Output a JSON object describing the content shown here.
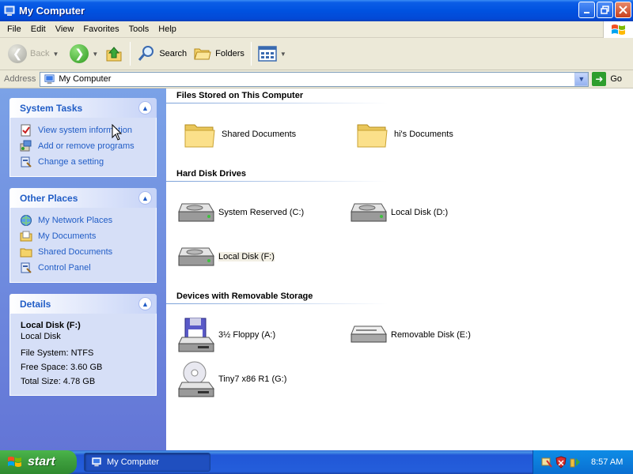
{
  "window": {
    "title": "My Computer",
    "menus": [
      "File",
      "Edit",
      "View",
      "Favorites",
      "Tools",
      "Help"
    ]
  },
  "toolbar": {
    "back_label": "Back",
    "search_label": "Search",
    "folders_label": "Folders"
  },
  "address": {
    "label": "Address",
    "value": "My Computer",
    "go_label": "Go"
  },
  "sidebar": {
    "system_tasks": {
      "title": "System Tasks",
      "items": [
        {
          "label": "View system information",
          "icon": "system-info-icon"
        },
        {
          "label": "Add or remove programs",
          "icon": "add-remove-programs-icon"
        },
        {
          "label": "Change a setting",
          "icon": "control-panel-icon"
        }
      ]
    },
    "other_places": {
      "title": "Other Places",
      "items": [
        {
          "label": "My Network Places",
          "icon": "network-places-icon"
        },
        {
          "label": "My Documents",
          "icon": "my-documents-icon"
        },
        {
          "label": "Shared Documents",
          "icon": "folder-icon"
        },
        {
          "label": "Control Panel",
          "icon": "control-panel-icon"
        }
      ]
    },
    "details": {
      "title": "Details",
      "name": "Local Disk (F:)",
      "type": "Local Disk",
      "file_system": "File System: NTFS",
      "free_space": "Free Space: 3.60 GB",
      "total_size": "Total Size: 4.78 GB"
    }
  },
  "main": {
    "sections": [
      {
        "title": "Files Stored on This Computer",
        "items": [
          {
            "label": "Shared Documents",
            "icon": "folder-icon"
          },
          {
            "label": "hi's Documents",
            "icon": "folder-icon"
          }
        ]
      },
      {
        "title": "Hard Disk Drives",
        "items": [
          {
            "label": "System Reserved (C:)",
            "icon": "hard-disk-icon"
          },
          {
            "label": "Local Disk (D:)",
            "icon": "hard-disk-icon"
          },
          {
            "label": "Local Disk (F:)",
            "icon": "hard-disk-icon"
          }
        ]
      },
      {
        "title": "Devices with Removable Storage",
        "items": [
          {
            "label": "3½ Floppy (A:)",
            "icon": "floppy-drive-icon"
          },
          {
            "label": "Removable Disk (E:)",
            "icon": "removable-disk-icon"
          },
          {
            "label": "Tiny7 x86 R1 (G:)",
            "icon": "cd-drive-icon"
          }
        ]
      }
    ]
  },
  "taskbar": {
    "start_label": "start",
    "task_label": "My Computer",
    "clock": "8:57 AM"
  }
}
